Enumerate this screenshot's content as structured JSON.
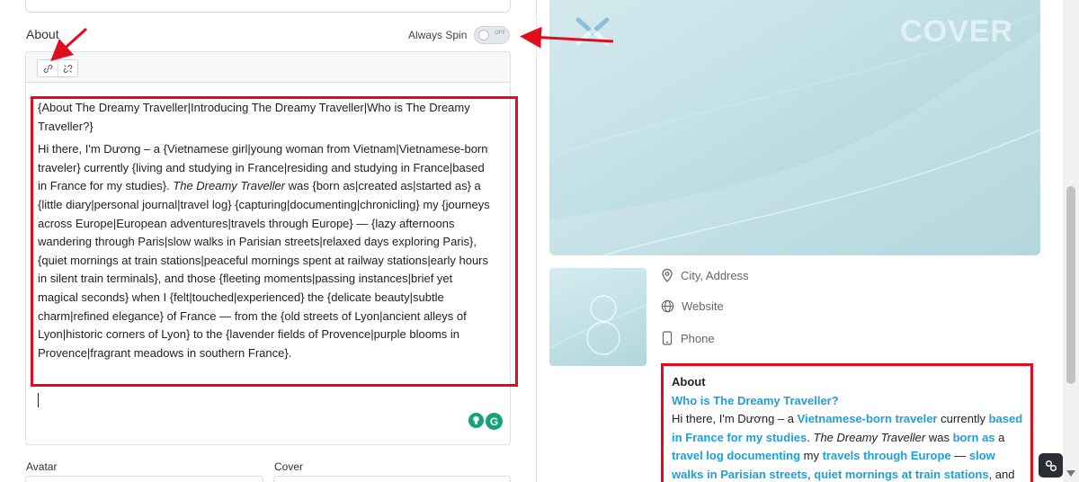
{
  "editor": {
    "about_label": "About",
    "always_spin_label": "Always Spin",
    "toggle_state": "OFF",
    "toggle_on": false,
    "toolbar": {
      "link_icon": "link-icon",
      "unlink_icon": "unlink-icon"
    },
    "paragraphs": [
      [
        {
          "t": "{About The Dreamy Traveller|Introducing The Dreamy Traveller|Who is The Dreamy Traveller?}"
        }
      ],
      [
        {
          "t": "Hi there, I'm Dương – a {Vietnamese girl|young woman from Vietnam|Vietnamese-born traveler} currently {living and studying in France|residing and studying in France|based in France for my studies}. "
        },
        {
          "t": "The Dreamy Traveller",
          "i": true
        },
        {
          "t": " was {born as|created as|started as} a {little diary|personal journal|travel log} {capturing|documenting|chronicling} my {journeys across Europe|European adventures|travels through Europe} — {lazy afternoons wandering through Paris|slow walks in Parisian streets|relaxed days exploring Paris}, {quiet mornings at train stations|peaceful mornings spent at railway stations|early hours in silent train terminals}, and those {fleeting moments|passing instances|brief yet magical seconds} when I {felt|touched|experienced} the {delicate beauty|subtle charm|refined elegance} of France — from the {old streets of Lyon|ancient alleys of Lyon|historic corners of Lyon} to the {lavender fields of Provence|purple blooms in Provence|fragrant meadows in southern France}."
        }
      ]
    ],
    "avatar_label": "Avatar",
    "cover_label": "Cover"
  },
  "preview": {
    "cover_text": "COVER",
    "city_address": "City, Address",
    "website": "Website",
    "phone": "Phone",
    "about_title": "About",
    "about_subtitle": "Who is The Dreamy Traveller?",
    "about_body": [
      {
        "t": "Hi there, I'm Dương – a "
      },
      {
        "t": "Vietnamese-born traveler",
        "h": true
      },
      {
        "t": " currently "
      },
      {
        "t": "based in France for my studies",
        "h": true
      },
      {
        "t": ". "
      },
      {
        "t": "The Dreamy Traveller",
        "i": true
      },
      {
        "t": " was "
      },
      {
        "t": "born as",
        "h": true
      },
      {
        "t": " a "
      },
      {
        "t": "travel log",
        "h": true
      },
      {
        "t": " "
      },
      {
        "t": "documenting",
        "h": true
      },
      {
        "t": " my "
      },
      {
        "t": "travels through Europe",
        "h": true
      },
      {
        "t": " — "
      },
      {
        "t": "slow walks in Parisian streets",
        "h": true
      },
      {
        "t": ", "
      },
      {
        "t": "quiet mornings at train stations",
        "h": true
      },
      {
        "t": ", and those"
      }
    ]
  },
  "colors": {
    "highlight_red": "#e10d1f",
    "accent_blue": "#1f9fd8",
    "grammarly_green": "#15a37a"
  }
}
